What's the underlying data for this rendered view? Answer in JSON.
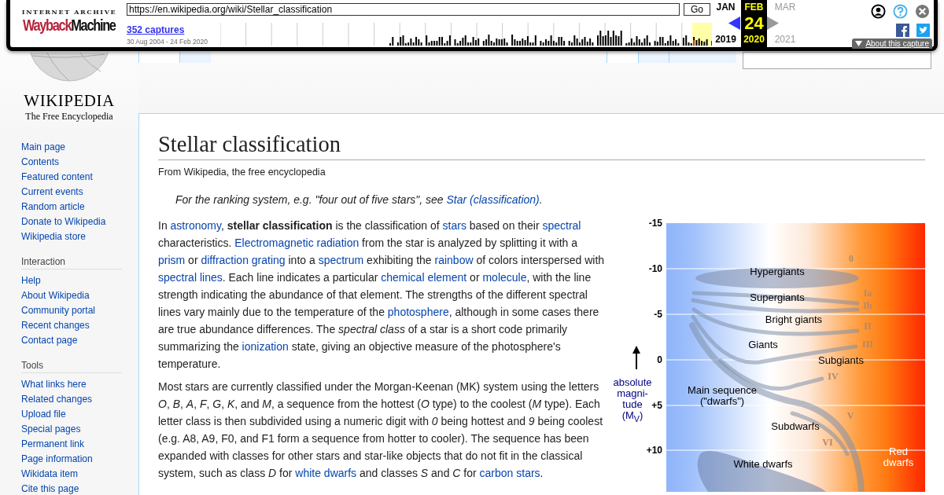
{
  "wayback": {
    "logo": {
      "top": "INTERNET ARCHIVE",
      "first": "Wayback",
      "second": "Machine"
    },
    "url": "https://en.wikipedia.org/wiki/Stellar_classification",
    "go": "Go",
    "captures": "352 captures",
    "range": "30 Aug 2004 - 24 Feb 2020",
    "months": [
      {
        "label": "JAN",
        "year": "2019",
        "selected": false,
        "kind": "prev",
        "arrow_disabled": false
      },
      {
        "label": "FEB",
        "day": "24",
        "year": "2020",
        "selected": true,
        "kind": "current"
      },
      {
        "label": "MAR",
        "year": "2021",
        "selected": false,
        "kind": "next",
        "arrow_disabled": true
      }
    ],
    "about": "About this capture"
  },
  "logo": {
    "name": "WIKIPEDIA",
    "tagline": "The Free Encyclopedia"
  },
  "tabs_left": [
    {
      "selected": true
    },
    {
      "selected": false
    }
  ],
  "tabs_right": [
    {
      "selected": true
    },
    {
      "selected": false
    },
    {
      "selected": false
    }
  ],
  "sidebar": [
    {
      "items": [
        "Main page",
        "Contents",
        "Featured content",
        "Current events",
        "Random article",
        "Donate to Wikipedia",
        "Wikipedia store"
      ]
    },
    {
      "heading": "Interaction",
      "items": [
        "Help",
        "About Wikipedia",
        "Community portal",
        "Recent changes",
        "Contact page"
      ]
    },
    {
      "heading": "Tools",
      "items": [
        "What links here",
        "Related changes",
        "Upload file",
        "Special pages",
        "Permanent link",
        "Page information",
        "Wikidata item",
        "Cite this page"
      ]
    }
  ],
  "article": {
    "title": "Stellar classification",
    "tagline": "From Wikipedia, the free encyclopedia",
    "hatnote": [
      {
        "kind": "text",
        "text": "For the ranking system, e.g. \"four out of five stars\", see "
      },
      {
        "kind": "link",
        "text": "Star (classification)"
      },
      {
        "kind": "text",
        "text": "."
      }
    ],
    "paragraphs": [
      [
        {
          "kind": "text",
          "text": "In "
        },
        {
          "kind": "link",
          "text": "astronomy"
        },
        {
          "kind": "text",
          "text": ", **stellar classification** is the classification of "
        },
        {
          "kind": "link",
          "text": "stars"
        },
        {
          "kind": "text",
          "text": " based on their "
        },
        {
          "kind": "link",
          "text": "spectral"
        },
        {
          "kind": "text",
          "text": " characteristics. "
        },
        {
          "kind": "link",
          "text": "Electromagnetic radiation"
        },
        {
          "kind": "text",
          "text": " from the star is analyzed by splitting it with a "
        },
        {
          "kind": "link",
          "text": "prism"
        },
        {
          "kind": "text",
          "text": " or "
        },
        {
          "kind": "link",
          "text": "diffraction grating"
        },
        {
          "kind": "text",
          "text": " into a "
        },
        {
          "kind": "link",
          "text": "spectrum"
        },
        {
          "kind": "text",
          "text": " exhibiting the "
        },
        {
          "kind": "link",
          "text": "rainbow"
        },
        {
          "kind": "text",
          "text": " of colors interspersed with "
        },
        {
          "kind": "link",
          "text": "spectral lines"
        },
        {
          "kind": "text",
          "text": ". Each line indicates a particular "
        },
        {
          "kind": "link",
          "text": "chemical element"
        },
        {
          "kind": "text",
          "text": " or "
        },
        {
          "kind": "link",
          "text": "molecule"
        },
        {
          "kind": "text",
          "text": ", with the line strength indicating the abundance of that element. The strengths of the different spectral lines vary mainly due to the temperature of the "
        },
        {
          "kind": "link",
          "text": "photosphere"
        },
        {
          "kind": "text",
          "text": ", although in some cases there are true abundance differences. The *spectral class* of a star is a short code primarily summarizing the "
        },
        {
          "kind": "link",
          "text": "ionization"
        },
        {
          "kind": "text",
          "text": " state, giving an objective measure of the photosphere's temperature."
        }
      ],
      [
        {
          "kind": "text",
          "text": "Most stars are currently classified under the Morgan-Keenan (MK) system using the letters *O*, *B*, *A*, *F*, *G*, *K*, and *M*, a sequence from the hottest (*O* type) to the coolest (*M* type). Each letter class is then subdivided using a numeric digit with *0* being hottest and *9* being coolest (e.g. A8, A9, F0, and F1 form a sequence from hotter to cooler). The sequence has been expanded with classes for other stars and star-like objects that do not fit in the classical system, such as class *D* for "
        },
        {
          "kind": "link",
          "text": "white dwarfs"
        },
        {
          "kind": "text",
          "text": " and classes *S* and *C* for "
        },
        {
          "kind": "link",
          "text": "carbon stars"
        },
        {
          "kind": "text",
          "text": "."
        }
      ]
    ]
  },
  "figure": {
    "ticks": [
      "-15",
      "-10",
      "-5",
      "0",
      "+5",
      "+10"
    ],
    "axis_label": [
      "absolute",
      "magni-",
      "tude",
      "(M$_{V}$)"
    ],
    "regions": [
      [
        "Hypergiants"
      ],
      [
        "Supergiants"
      ],
      [
        "Bright giants"
      ],
      [
        "Giants"
      ],
      [
        "Subgiants"
      ],
      [
        "Main sequence",
        "(\"dwarfs\")"
      ],
      [
        "Subdwarfs"
      ],
      [
        "White dwarfs"
      ],
      [
        "Red",
        "dwarfs"
      ]
    ],
    "classes": [
      "0",
      "Ia",
      "Ib",
      "II",
      "III",
      "IV",
      "V",
      "VI"
    ]
  }
}
